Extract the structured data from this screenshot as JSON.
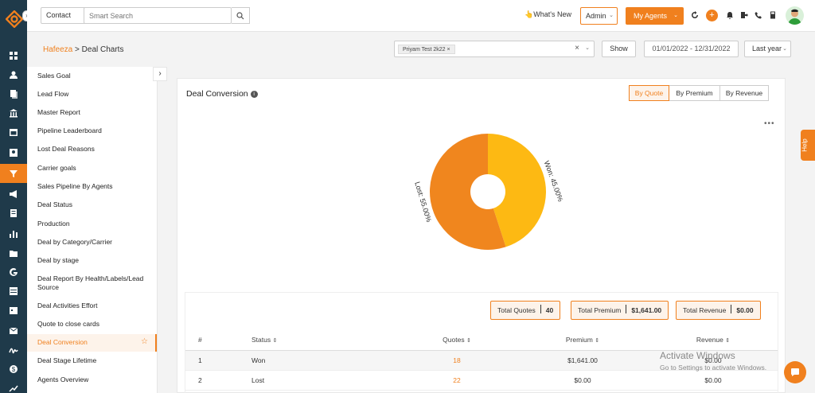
{
  "topbar": {
    "contact_select": "Contact",
    "search_placeholder": "Smart Search",
    "whats_new": "What's New",
    "admin": "Admin",
    "my_agents": "My Agents"
  },
  "subbar": {
    "breadcrumb_link": "Hafeeza",
    "breadcrumb_separator": ">",
    "breadcrumb_current": "Deal Charts",
    "agent_chip": "Priyam Test 2k22",
    "show": "Show",
    "date_range": "01/01/2022 - 12/31/2022",
    "period": "Last year"
  },
  "menu": {
    "items": [
      "Sales Goal",
      "Lead Flow",
      "Master Report",
      "Pipeline Leaderboard",
      "Lost Deal Reasons",
      "Carrier goals",
      "Sales Pipeline By Agents",
      "Deal Status",
      "Production",
      "Deal by Category/Carrier",
      "Deal by stage",
      "Deal Report By Health/Labels/Lead Source",
      "Deal Activities Effort",
      "Quote to close cards",
      "Deal Conversion",
      "Deal Stage Lifetime",
      "Agents Overview"
    ]
  },
  "card": {
    "title": "Deal Conversion",
    "info": "i",
    "tabs": [
      "By Quote",
      "By Premium",
      "By Revenue"
    ]
  },
  "chart_data": {
    "type": "pie",
    "title": "",
    "labels": [
      "Won",
      "Lost"
    ],
    "values": [
      45.0,
      55.0
    ],
    "slice_labels": [
      "Won: 45.00%",
      "Lost: 55.00%"
    ],
    "colors": [
      "#fdb913",
      "#f0861e"
    ],
    "donut": true
  },
  "stats": [
    {
      "label": "Total Quotes",
      "value": "40"
    },
    {
      "label": "Total Premium",
      "value": "$1,641.00"
    },
    {
      "label": "Total Revenue",
      "value": "$0.00"
    }
  ],
  "table": {
    "headers": [
      "#",
      "Status",
      "Quotes",
      "Premium",
      "Revenue"
    ],
    "rows": [
      [
        "1",
        "Won",
        "18",
        "$1,641.00",
        "$0.00"
      ],
      [
        "2",
        "Lost",
        "22",
        "$0.00",
        "$0.00"
      ]
    ]
  },
  "help": "Help",
  "watermark": {
    "title": "Activate Windows",
    "sub": "Go to Settings to activate Windows."
  },
  "colors": {
    "accent": "#f0801e",
    "rail": "#1f3a4a"
  }
}
